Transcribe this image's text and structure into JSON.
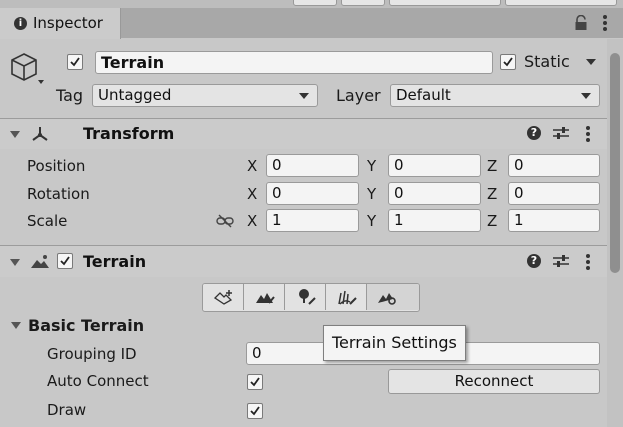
{
  "tab": {
    "title": "Inspector"
  },
  "object": {
    "name": "Terrain",
    "active": true,
    "static_label": "Static",
    "static": true,
    "tag_label": "Tag",
    "tag_value": "Untagged",
    "layer_label": "Layer",
    "layer_value": "Default"
  },
  "transform": {
    "title": "Transform",
    "rows": [
      {
        "label": "Position",
        "x": "0",
        "y": "0",
        "z": "0"
      },
      {
        "label": "Rotation",
        "x": "0",
        "y": "0",
        "z": "0"
      },
      {
        "label": "Scale",
        "x": "1",
        "y": "1",
        "z": "1"
      }
    ],
    "axis": {
      "x": "X",
      "y": "Y",
      "z": "Z"
    }
  },
  "terrain": {
    "title": "Terrain",
    "enabled": true,
    "tools": [
      "create-neighbor-terrains-icon",
      "paint-terrain-icon",
      "paint-trees-icon",
      "paint-details-icon",
      "terrain-settings-icon"
    ],
    "tooltip": "Terrain Settings",
    "section": "Basic Terrain",
    "grouping_label": "Grouping ID",
    "grouping_value": "0",
    "auto_connect_label": "Auto Connect",
    "auto_connect": true,
    "reconnect_label": "Reconnect",
    "draw_label": "Draw",
    "draw": true
  }
}
